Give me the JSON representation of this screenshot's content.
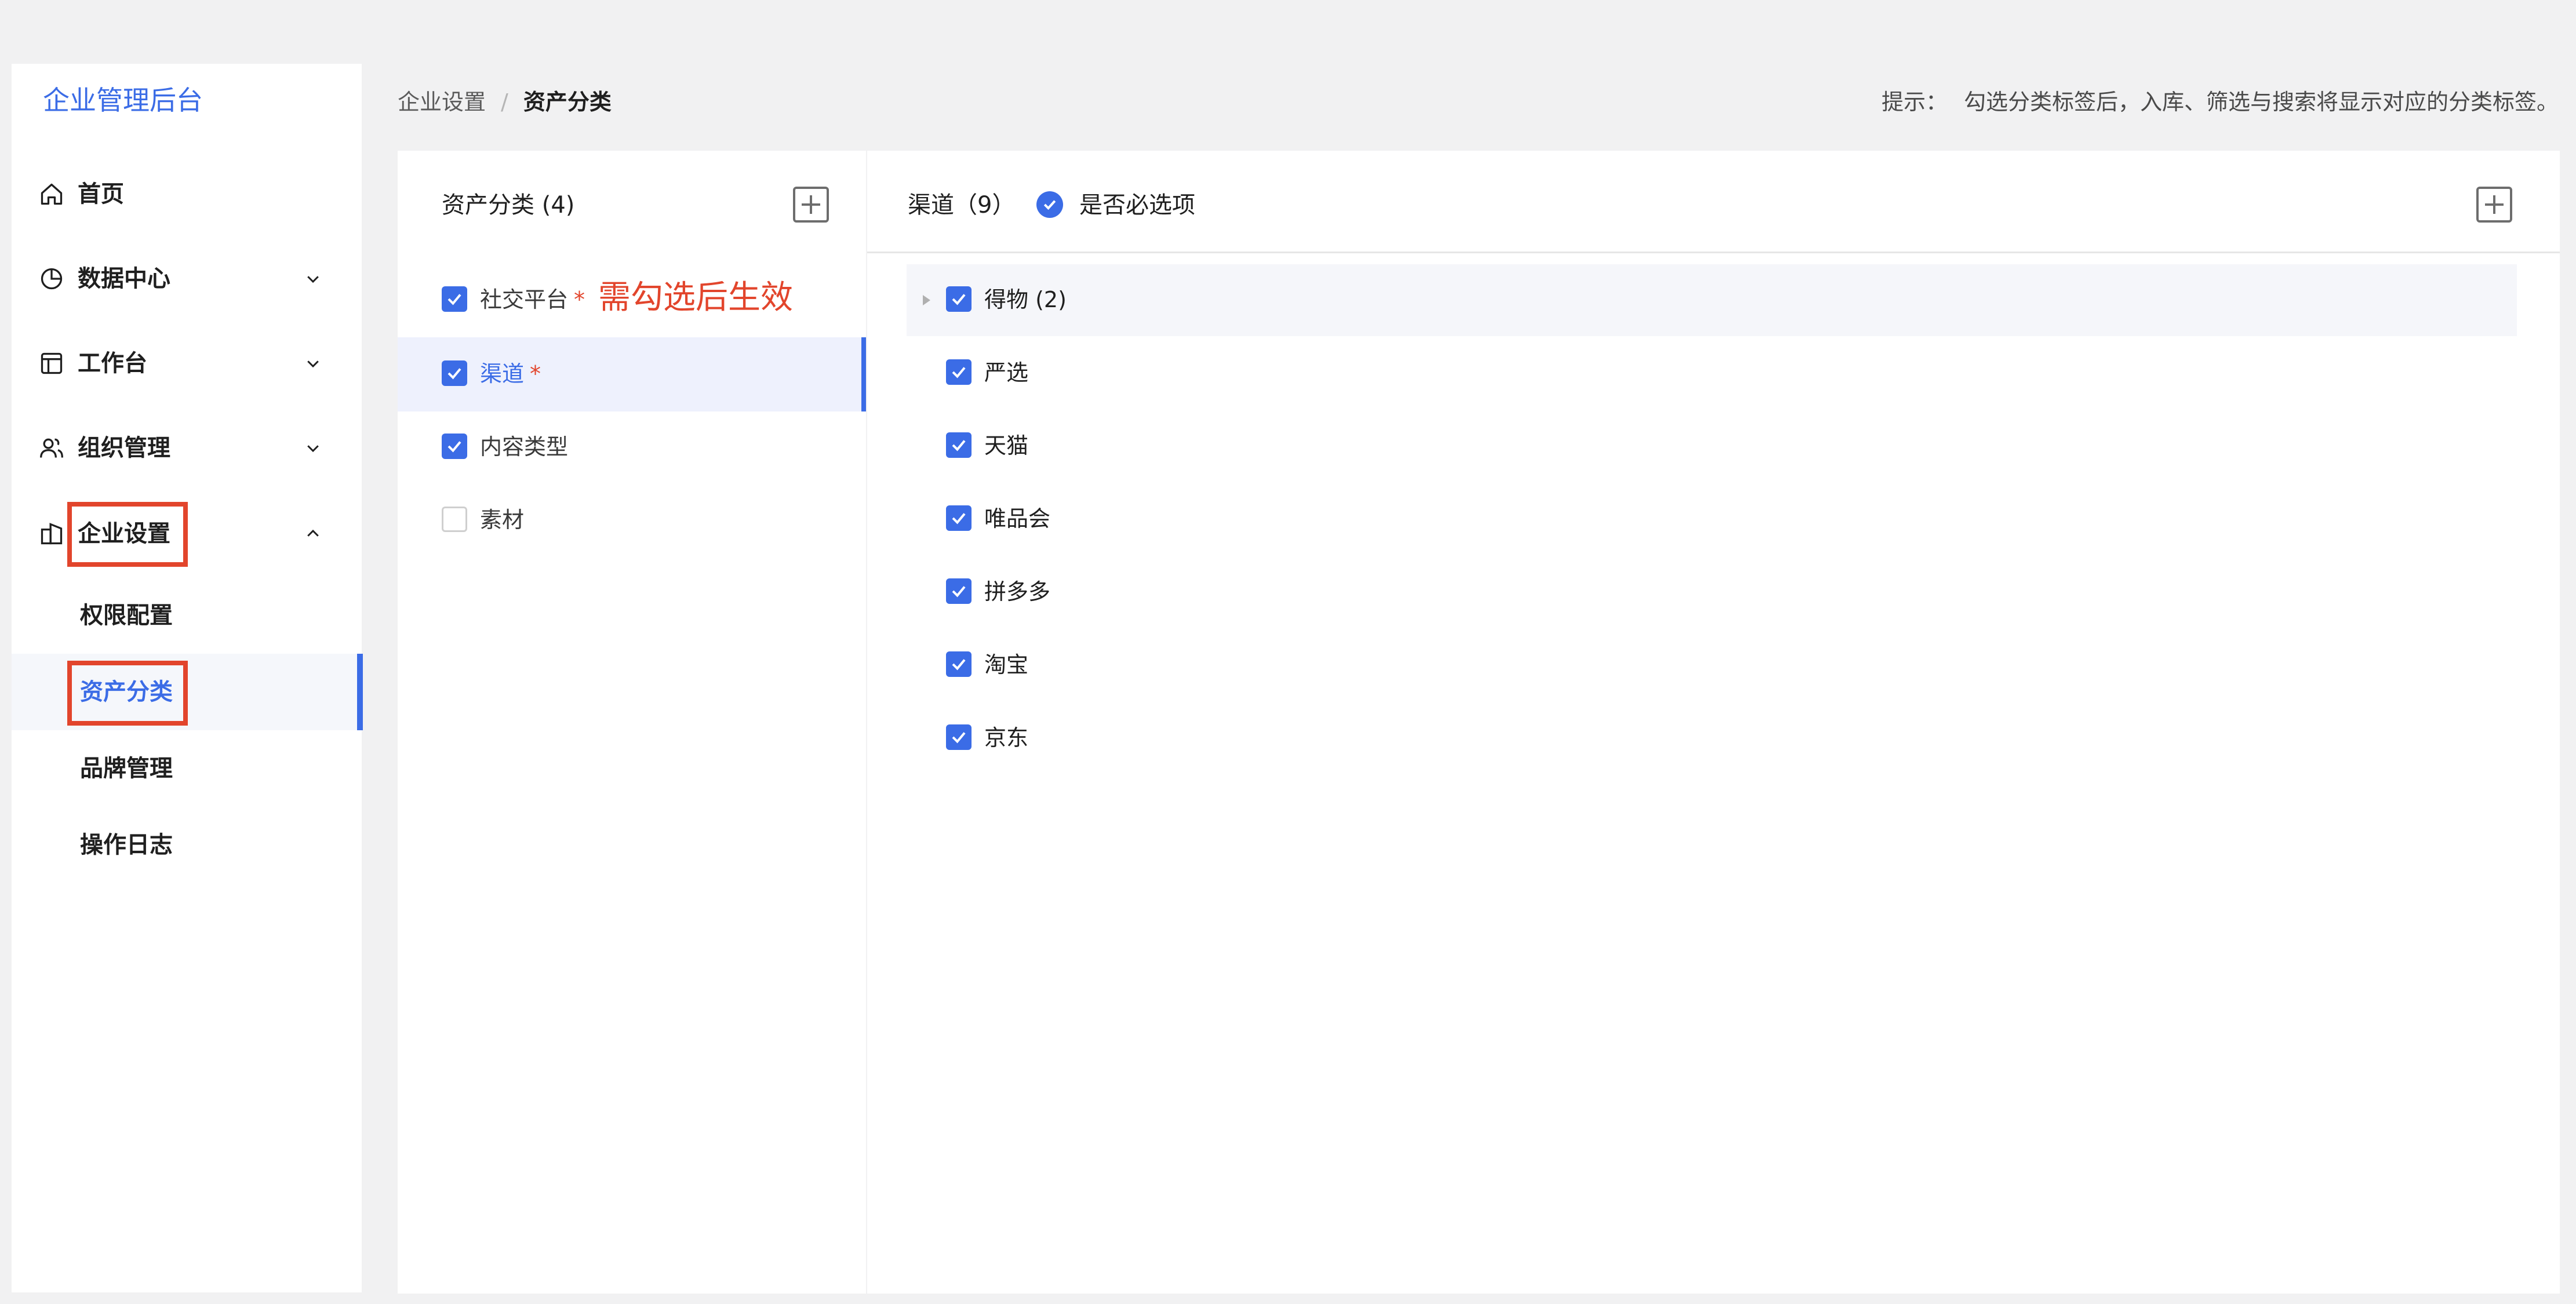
{
  "sidebar": {
    "brand": "企业管理后台",
    "nav": [
      {
        "label": "首页",
        "icon": "home-icon"
      },
      {
        "label": "数据中心",
        "icon": "pie-chart-icon"
      },
      {
        "label": "工作台",
        "icon": "workbench-icon"
      },
      {
        "label": "组织管理",
        "icon": "users-icon"
      },
      {
        "label": "企业设置",
        "icon": "building-icon"
      }
    ],
    "sub_items": [
      {
        "label": "权限配置"
      },
      {
        "label": "资产分类"
      },
      {
        "label": "品牌管理"
      },
      {
        "label": "操作日志"
      }
    ],
    "active_sub": "资产分类"
  },
  "header": {
    "breadcrumb": [
      "企业设置",
      "资产分类"
    ],
    "separator": "/",
    "hint_label": "提示：",
    "hint_text": "勾选分类标签后，入库、筛选与搜索将显示对应的分类标签。"
  },
  "left_panel": {
    "title": "资产分类 (4)",
    "items": [
      {
        "label": "社交平台",
        "required": "*",
        "checked": true
      },
      {
        "label": "渠道",
        "required": "*",
        "checked": true
      },
      {
        "label": "内容类型",
        "required": "",
        "checked": true
      },
      {
        "label": "素材",
        "required": "",
        "checked": false
      }
    ],
    "annotation": "需勾选后生效"
  },
  "right_panel": {
    "title": "渠道（9）",
    "required_toggle_label": "是否必选项",
    "parent": {
      "label": "得物 (2)",
      "checked": true
    },
    "children": [
      {
        "label": "严选",
        "checked": true
      },
      {
        "label": "天猫",
        "checked": true
      },
      {
        "label": "唯品会",
        "checked": true
      },
      {
        "label": "拼多多",
        "checked": true
      },
      {
        "label": "淘宝",
        "checked": true
      },
      {
        "label": "京东",
        "checked": true
      }
    ]
  },
  "colors": {
    "accent": "#3b6ce6",
    "highlight": "#e2452c",
    "active_row_bg": "#eef1fd"
  }
}
